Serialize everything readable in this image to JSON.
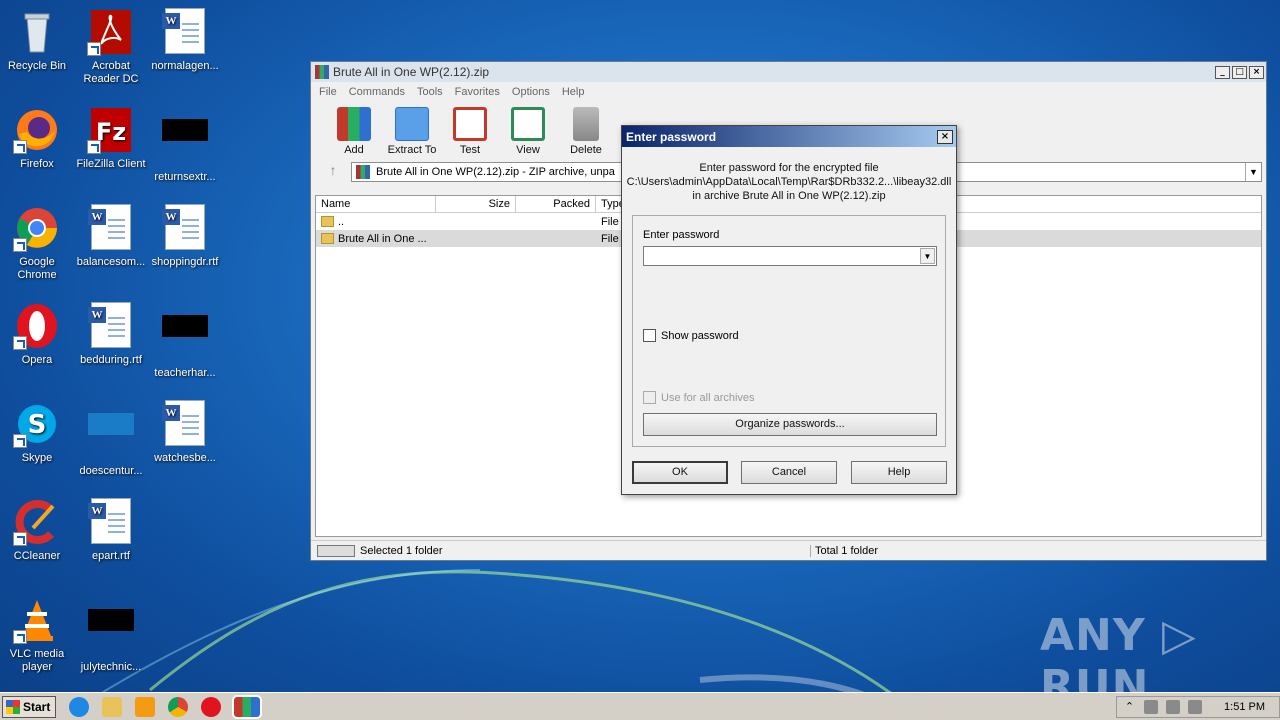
{
  "desktop": {
    "icons": [
      {
        "label": "Recycle Bin"
      },
      {
        "label": "Acrobat Reader DC"
      },
      {
        "label": "normalagen..."
      },
      {
        "label": "Firefox"
      },
      {
        "label": "FileZilla Client"
      },
      {
        "label": "returnsextr..."
      },
      {
        "label": "Google Chrome"
      },
      {
        "label": "balancesom..."
      },
      {
        "label": "shoppingdr.rtf"
      },
      {
        "label": "Opera"
      },
      {
        "label": "bedduring.rtf"
      },
      {
        "label": "teacherhar..."
      },
      {
        "label": "Skype"
      },
      {
        "label": "doescentur..."
      },
      {
        "label": "watchesbe..."
      },
      {
        "label": "CCleaner"
      },
      {
        "label": "epart.rtf"
      },
      {
        "label": "VLC media player"
      },
      {
        "label": "julytechnic..."
      }
    ],
    "watermark": "ANY ▷ RUN"
  },
  "window": {
    "title": "Brute All in One WP(2.12).zip",
    "minimize": "_",
    "maximize": "□",
    "close": "×",
    "menu": [
      "File",
      "Commands",
      "Tools",
      "Favorites",
      "Options",
      "Help"
    ],
    "toolbar": [
      {
        "label": "Add",
        "color": "#c0392b"
      },
      {
        "label": "Extract To",
        "color": "#2e7bd0"
      },
      {
        "label": "Test",
        "color": "#c0392b"
      },
      {
        "label": "View",
        "color": "#2e8b57"
      },
      {
        "label": "Delete",
        "color": "#888888"
      }
    ],
    "address": "Brute All in One WP(2.12).zip - ZIP archive, unpa",
    "up_arrow": "↑",
    "columns": {
      "name": "Name",
      "size": "Size",
      "packed": "Packed",
      "type": "Type"
    },
    "rows": [
      {
        "name": "..",
        "type": "File f"
      },
      {
        "name": "Brute All in One ...",
        "type": "File f"
      }
    ],
    "status_left": "Selected 1 folder",
    "status_right": "Total 1 folder"
  },
  "dialog": {
    "title": "Enter password",
    "close": "×",
    "message_line1": "Enter password for the encrypted file",
    "message_line2": "C:\\Users\\admin\\AppData\\Local\\Temp\\Rar$DRb332.2...\\libeay32.dll",
    "message_line3": "in archive Brute All in One WP(2.12).zip",
    "field_label": "Enter password",
    "field_value": "",
    "show_password": "Show password",
    "use_for_all": "Use for all archives",
    "organize": "Organize passwords...",
    "ok": "OK",
    "cancel": "Cancel",
    "help": "Help"
  },
  "taskbar": {
    "start": "Start",
    "clock": "1:51 PM",
    "tray_arrow": "⌃"
  }
}
